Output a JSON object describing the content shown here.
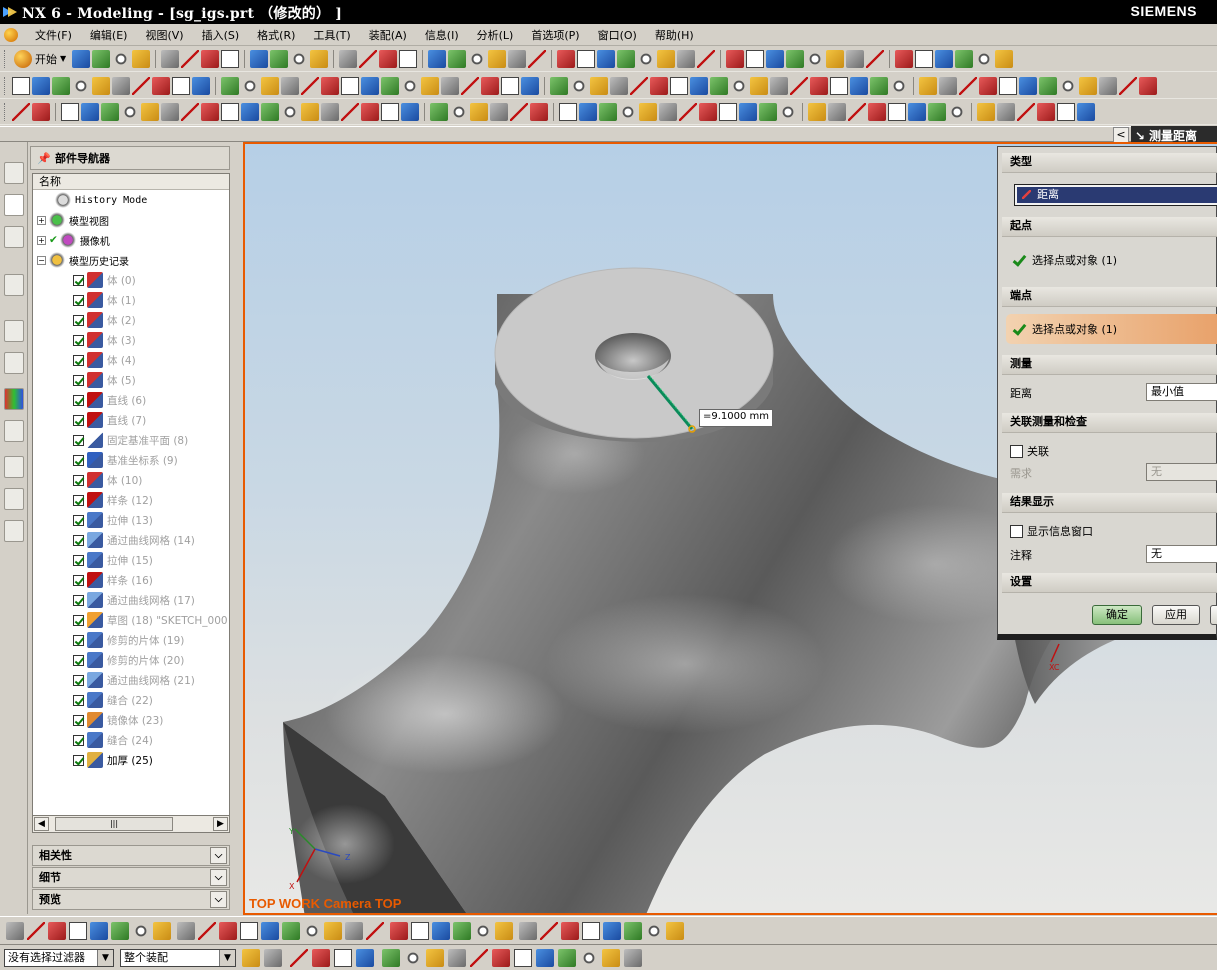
{
  "window": {
    "title": "NX 6 - Modeling - [sg_igs.prt （修改的） ]",
    "brand": "SIEMENS"
  },
  "menu": [
    "文件(F)",
    "编辑(E)",
    "视图(V)",
    "插入(S)",
    "格式(R)",
    "工具(T)",
    "装配(A)",
    "信息(I)",
    "分析(L)",
    "首选项(P)",
    "窗口(O)",
    "帮助(H)"
  ],
  "toolbar": {
    "start_label": "开始"
  },
  "dialog_tab": {
    "label": "测量距离"
  },
  "navigator": {
    "title": "部件导航器",
    "column_header": "名称",
    "top_items": [
      {
        "label": "History Mode",
        "icon": "clock-icon"
      },
      {
        "label": "模型视图",
        "icon": "model-view-icon"
      },
      {
        "label": "摄像机",
        "icon": "camera-icon"
      },
      {
        "label": "模型历史记录",
        "icon": "folder-icon"
      }
    ],
    "history": [
      {
        "label": "体 (0)",
        "icon": "body-icon"
      },
      {
        "label": "体 (1)",
        "icon": "body-icon"
      },
      {
        "label": "体 (2)",
        "icon": "body-icon"
      },
      {
        "label": "体 (3)",
        "icon": "body-icon"
      },
      {
        "label": "体 (4)",
        "icon": "body-icon"
      },
      {
        "label": "体 (5)",
        "icon": "body-icon"
      },
      {
        "label": "直线 (6)",
        "icon": "line-icon"
      },
      {
        "label": "直线 (7)",
        "icon": "line-icon"
      },
      {
        "label": "固定基准平面 (8)",
        "icon": "datum-plane-icon"
      },
      {
        "label": "基准坐标系 (9)",
        "icon": "datum-csys-icon"
      },
      {
        "label": "体 (10)",
        "icon": "body-icon"
      },
      {
        "label": "样条 (12)",
        "icon": "spline-icon"
      },
      {
        "label": "拉伸 (13)",
        "icon": "extrude-icon"
      },
      {
        "label": "通过曲线网格 (14)",
        "icon": "mesh-surface-icon"
      },
      {
        "label": "拉伸 (15)",
        "icon": "extrude-icon"
      },
      {
        "label": "样条 (16)",
        "icon": "spline-icon"
      },
      {
        "label": "通过曲线网格 (17)",
        "icon": "mesh-surface-icon"
      },
      {
        "label": "草图 (18) \"SKETCH_000",
        "icon": "sketch-icon"
      },
      {
        "label": "修剪的片体 (19)",
        "icon": "trimmed-sheet-icon"
      },
      {
        "label": "修剪的片体 (20)",
        "icon": "trimmed-sheet-icon"
      },
      {
        "label": "通过曲线网格 (21)",
        "icon": "mesh-surface-icon"
      },
      {
        "label": "缝合 (22)",
        "icon": "sew-icon"
      },
      {
        "label": "镜像体 (23)",
        "icon": "mirror-body-icon"
      },
      {
        "label": "缝合 (24)",
        "icon": "sew-icon"
      },
      {
        "label": "加厚 (25)",
        "icon": "thicken-icon"
      }
    ],
    "sections": [
      "相关性",
      "细节",
      "预览"
    ]
  },
  "viewport": {
    "label": "TOP WORK Camera TOP",
    "dimension": "=9.1000 mm",
    "background_top": "#b6cfe6",
    "border_color": "#e85a00"
  },
  "dialog": {
    "type_section": "类型",
    "type_value": "距离",
    "start_section": "起点",
    "start_select": "选择点或对象 (1)",
    "end_section": "端点",
    "end_select": "选择点或对象 (1)",
    "measure_section": "测量",
    "distance_label": "距离",
    "distance_value": "最小值",
    "assoc_section": "关联测量和检查",
    "assoc_checkbox": "关联",
    "requirement_label": "需求",
    "requirement_value": "无",
    "result_section": "结果显示",
    "show_info_checkbox": "显示信息窗口",
    "annotation_label": "注释",
    "annotation_value": "无",
    "settings_section": "设置",
    "ok_button": "确定",
    "apply_button": "应用"
  },
  "status": {
    "filter_value": "没有选择过滤器",
    "scope_value": "整个装配"
  }
}
